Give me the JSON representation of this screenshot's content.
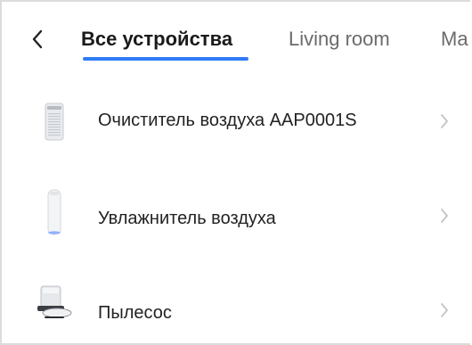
{
  "header": {
    "tabs": [
      {
        "label": "Все устройства",
        "active": true
      },
      {
        "label": "Living room",
        "active": false
      },
      {
        "label": "Ma",
        "active": false
      }
    ]
  },
  "devices": [
    {
      "name": "Очиститель воздуха AAP0001S",
      "icon": "air-purifier-image"
    },
    {
      "name": "Увлажнитель воздуха",
      "icon": "humidifier-image"
    },
    {
      "name": "Пылесос",
      "icon": "robot-vacuum-image"
    }
  ],
  "colors": {
    "accent": "#2f7cf6",
    "text": "#1f1f1f",
    "muted": "#6b6b6b",
    "chevron": "#c4c4c4"
  }
}
